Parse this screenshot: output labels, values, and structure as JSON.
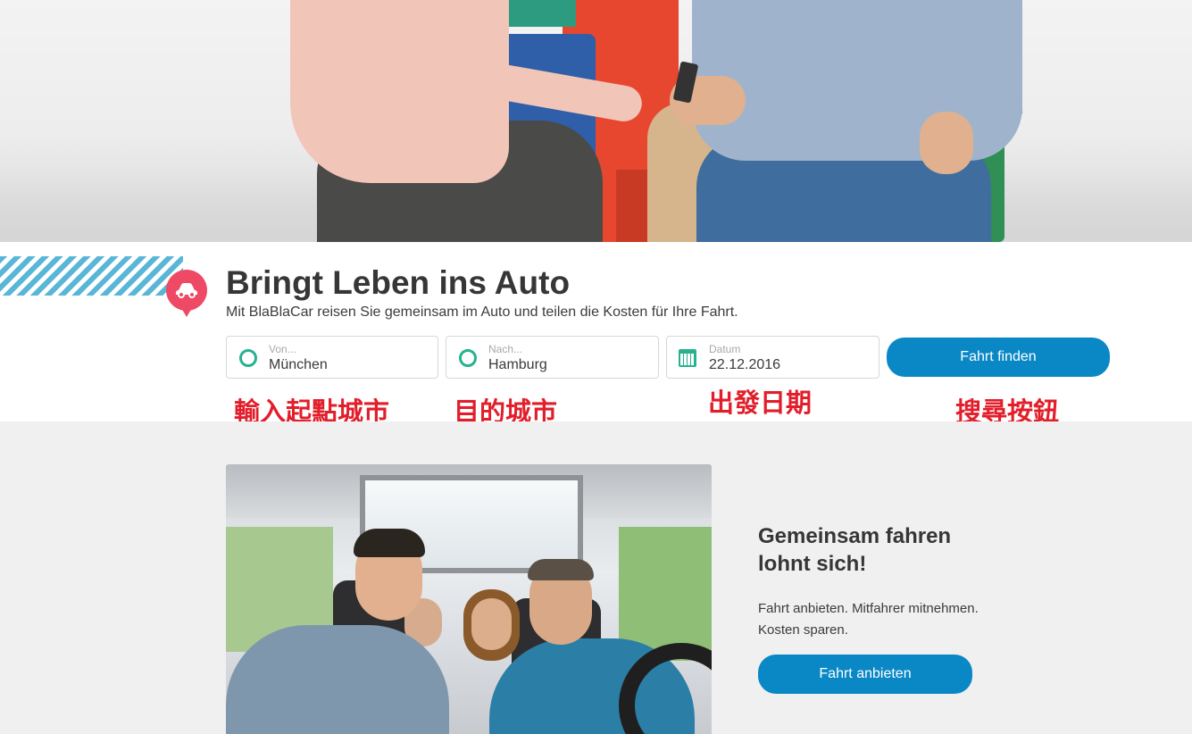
{
  "hero": {
    "image": "people-sitting-on-chairs"
  },
  "search": {
    "headline": "Bringt Leben ins Auto",
    "subline": "Mit BlaBlaCar reisen Sie gemeinsam im Auto und teilen die Kosten für Ihre Fahrt.",
    "from": {
      "placeholder": "Von...",
      "value": "München"
    },
    "to": {
      "placeholder": "Nach...",
      "value": "Hamburg"
    },
    "date": {
      "placeholder": "Datum",
      "value": "22.12.2016"
    },
    "find_button": "Fahrt finden"
  },
  "annotations": {
    "from_note": "輸入起點城市",
    "to_note": "目的城市",
    "date_note": "出發日期",
    "button_note": "搜尋按鈕"
  },
  "promo": {
    "title_line1": "Gemeinsam fahren",
    "title_line2": "lohnt sich!",
    "text_line1": "Fahrt anbieten. Mitfahrer mitnehmen.",
    "text_line2": "Kosten sparen.",
    "offer_button": "Fahrt anbieten"
  },
  "colors": {
    "accent_blue": "#0a88c6",
    "brand_pink": "#ee4965",
    "input_green": "#27b28f",
    "annotation_red": "#e21e2a",
    "chevron_blue": "#59b6d7"
  },
  "icons": [
    "car-icon",
    "origin-circle-icon",
    "destination-circle-icon",
    "calendar-icon"
  ]
}
